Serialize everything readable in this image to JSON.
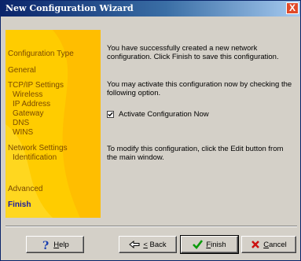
{
  "window": {
    "title": "New Configuration Wizard",
    "close_glyph": "X"
  },
  "sidebar": {
    "background": "#ffcc00",
    "items": [
      {
        "label": "Configuration Type"
      },
      {
        "label": "General"
      },
      {
        "label": "TCP/IP Settings"
      },
      {
        "label": "Wireless"
      },
      {
        "label": "IP Address"
      },
      {
        "label": "Gateway"
      },
      {
        "label": "DNS"
      },
      {
        "label": "WINS"
      },
      {
        "label": "Network Settings"
      },
      {
        "label": "Identification"
      },
      {
        "label": "Advanced"
      },
      {
        "label": "Finish",
        "active": true
      }
    ]
  },
  "content": {
    "message1": "You have successfully created a new network configuration. Click Finish to save this configuration.",
    "message2": "You may activate this configuration now by checking the following option.",
    "checkbox_label": "Activate Configuration Now",
    "checkbox_checked": true,
    "message3": "To modify this configuration, click the Edit button from the main window."
  },
  "buttons": {
    "help": "Help",
    "back": "< Back",
    "finish": "Finish",
    "cancel": "Cancel"
  },
  "icons": {
    "help": "question-mark-icon",
    "back": "left-arrow-icon",
    "finish": "green-check-icon",
    "cancel": "red-x-icon"
  }
}
